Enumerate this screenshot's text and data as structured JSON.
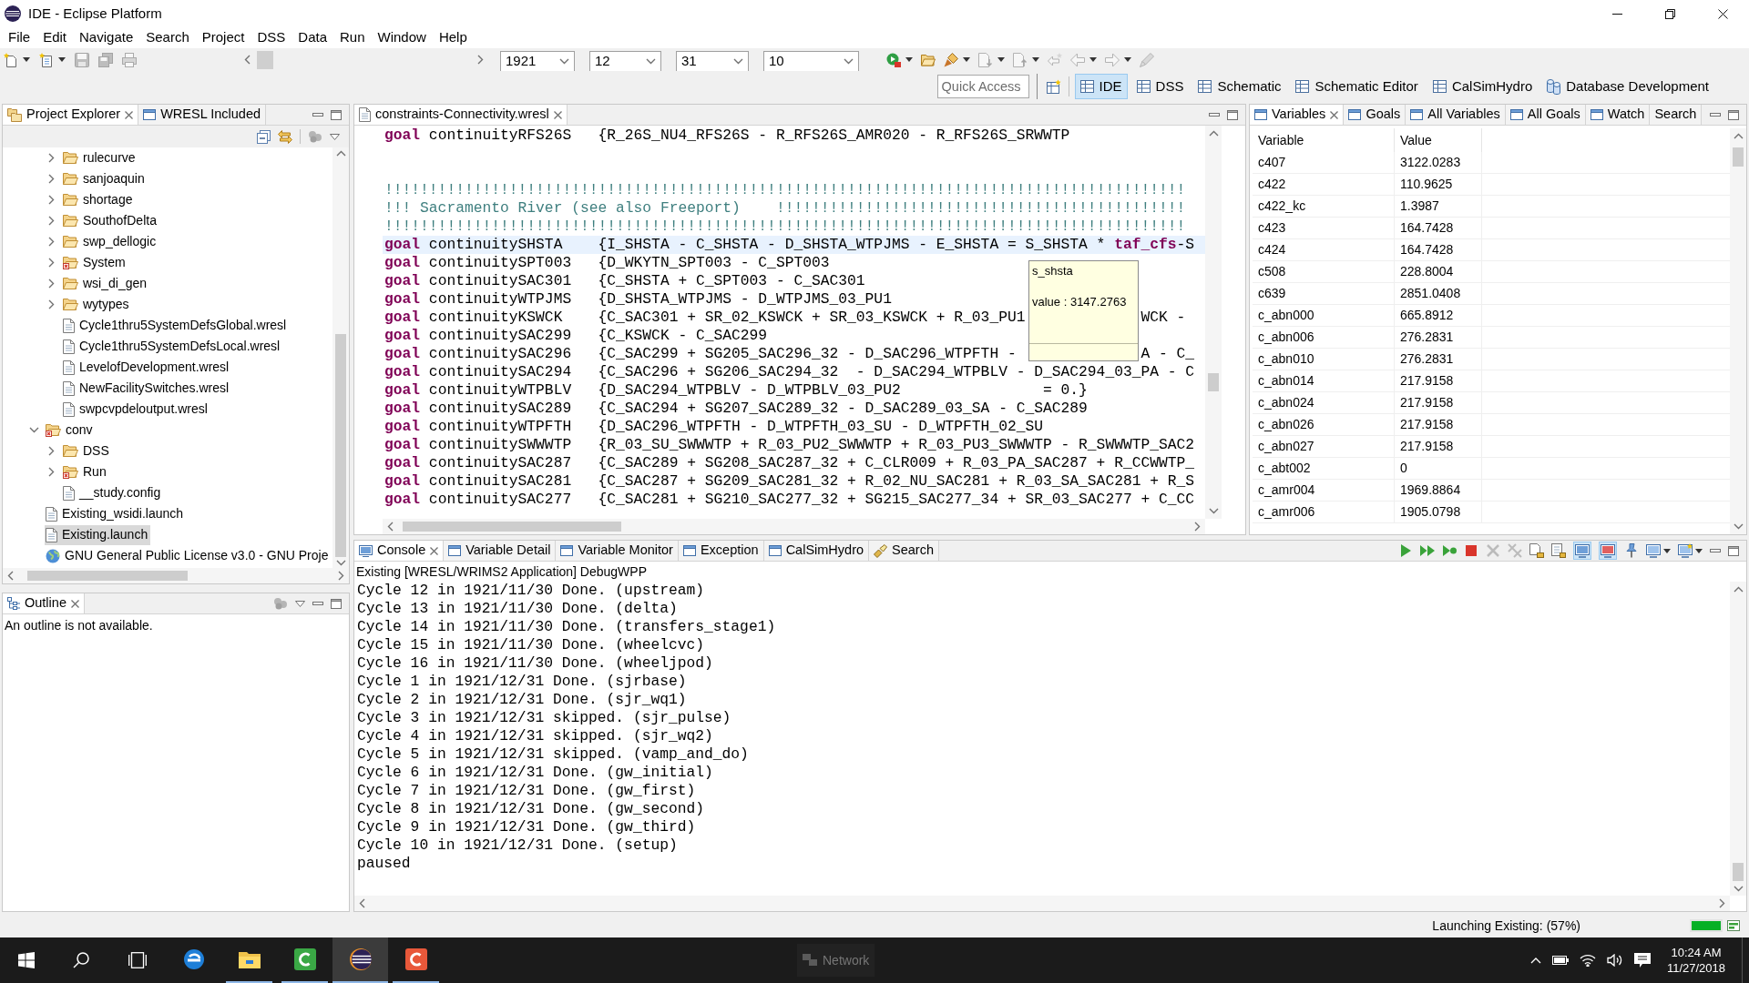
{
  "window": {
    "title": "IDE - Eclipse Platform"
  },
  "menu": [
    "File",
    "Edit",
    "Navigate",
    "Search",
    "Project",
    "DSS",
    "Data",
    "Run",
    "Window",
    "Help"
  ],
  "toolbar": {
    "file_buttons": [
      {
        "disabled": false,
        "dropdown": true
      },
      {
        "disabled": false,
        "dropdown": true
      },
      {
        "disabled": true,
        "dropdown": false
      },
      {
        "disabled": true,
        "dropdown": false
      },
      {
        "disabled": true,
        "dropdown": false
      }
    ],
    "date_fields": [
      {
        "value": "1921"
      },
      {
        "value": "12"
      },
      {
        "value": "31"
      },
      {
        "value": "10"
      }
    ],
    "run_buttons": [
      {
        "disabled": false,
        "dropdown": true
      },
      {
        "disabled": false,
        "dropdown": false
      },
      {
        "disabled": false,
        "dropdown": true
      },
      {
        "disabled": true,
        "dropdown": true
      },
      {
        "disabled": true,
        "dropdown": true
      },
      {
        "disabled": true,
        "dropdown": false
      },
      {
        "disabled": true,
        "dropdown": true
      },
      {
        "disabled": true,
        "dropdown": true
      },
      {
        "disabled": true,
        "dropdown": false
      }
    ],
    "quick_access": {
      "placeholder": "Quick Access"
    },
    "perspectives": [
      {
        "label": "IDE",
        "kind": "grid",
        "selected": true
      },
      {
        "label": "DSS",
        "kind": "grid",
        "selected": false
      },
      {
        "label": "Schematic",
        "kind": "grid",
        "selected": false
      },
      {
        "label": "Schematic Editor",
        "kind": "grid",
        "selected": false
      },
      {
        "label": "CalSimHydro",
        "kind": "grid",
        "selected": false
      },
      {
        "label": "Database Development",
        "kind": "database",
        "selected": false
      }
    ]
  },
  "project_explorer": {
    "tabs": [
      {
        "label": "Project Explorer",
        "kind": "explorer",
        "selected": true
      },
      {
        "label": "WRESL Included",
        "kind": "view",
        "selected": false
      }
    ],
    "tree": {
      "continued_children": [
        {
          "label": "rulecurve",
          "kind": "folder",
          "expanded": false,
          "error": false,
          "selected": false
        },
        {
          "label": "sanjoaquin",
          "kind": "folder",
          "expanded": false,
          "error": false,
          "selected": false
        },
        {
          "label": "shortage",
          "kind": "folder",
          "expanded": false,
          "error": false,
          "selected": false
        },
        {
          "label": "SouthofDelta",
          "kind": "folder",
          "expanded": false,
          "error": false,
          "selected": false
        },
        {
          "label": "swp_dellogic",
          "kind": "folder",
          "expanded": false,
          "error": false,
          "selected": false
        },
        {
          "label": "System",
          "kind": "folder",
          "expanded": false,
          "error": true,
          "selected": false
        },
        {
          "label": "wsi_di_gen",
          "kind": "folder",
          "expanded": false,
          "error": false,
          "selected": false
        },
        {
          "label": "wytypes",
          "kind": "folder",
          "expanded": false,
          "error": false,
          "selected": false
        },
        {
          "label": "Cycle1thru5SystemDefsGlobal.wresl",
          "kind": "file",
          "error": false,
          "selected": false
        },
        {
          "label": "Cycle1thru5SystemDefsLocal.wresl",
          "kind": "file",
          "error": false,
          "selected": false
        },
        {
          "label": "LevelofDevelopment.wresl",
          "kind": "file",
          "error": false,
          "selected": false
        },
        {
          "label": "NewFacilitySwitches.wresl",
          "kind": "file",
          "error": false,
          "selected": false
        },
        {
          "label": "swpcvpdeloutput.wresl",
          "kind": "file",
          "error": false,
          "selected": false
        }
      ],
      "items": [
        {
          "label": "conv",
          "kind": "folder",
          "expanded": true,
          "error": true,
          "selected": false,
          "children": [
            {
              "label": "DSS",
              "kind": "folder",
              "expanded": false,
              "error": false,
              "selected": false
            },
            {
              "label": "Run",
              "kind": "folder",
              "expanded": false,
              "error": true,
              "selected": false
            },
            {
              "label": "__study.config",
              "kind": "file",
              "error": false,
              "selected": false
            }
          ]
        },
        {
          "label": "Existing_wsidi.launch",
          "kind": "file",
          "error": false,
          "selected": false
        },
        {
          "label": "Existing.launch",
          "kind": "file",
          "error": false,
          "selected": true
        },
        {
          "label": "GNU General Public License v3.0 - GNU Proje",
          "kind": "link",
          "error": false,
          "selected": false
        }
      ]
    }
  },
  "outline": {
    "tabs": [
      {
        "label": "Outline",
        "kind": "outline",
        "selected": true
      }
    ],
    "message": "An outline is not available."
  },
  "editor": {
    "tabs": [
      {
        "label": "constraints-Connectivity.wresl",
        "kind": "file",
        "selected": true
      }
    ],
    "lines": [
      {
        "kind": "goal",
        "keyword": "goal",
        "name": "continuityRFS26S",
        "expr": "{R_26S_NU4_RFS26S - R_RFS26S_AMR020 - R_RFS26S_SRWWTP",
        "current": false
      },
      {
        "kind": "blank",
        "current": false
      },
      {
        "kind": "blank",
        "current": false
      },
      {
        "kind": "comment",
        "text": "!!!!!!!!!!!!!!!!!!!!!!!!!!!!!!!!!!!!!!!!!!!!!!!!!!!!!!!!!!!!!!!!!!!!!!!!!!!!!!!!!!!!!!!!!!",
        "current": false
      },
      {
        "kind": "comment",
        "text": "!!! Sacramento River (see also Freeport)    !!!!!!!!!!!!!!!!!!!!!!!!!!!!!!!!!!!!!!!!!!!!!!",
        "current": false
      },
      {
        "kind": "comment",
        "text": "!!!!!!!!!!!!!!!!!!!!!!!!!!!!!!!!!!!!!!!!!!!!!!!!!!!!!!!!!!!!!!!!!!!!!!!!!!!!!!!!!!!!!!!!!!",
        "current": false
      },
      {
        "kind": "goal",
        "keyword": "goal",
        "name": "continuitySHSTA",
        "expr": "{I_SHSTA - C_SHSTA - D_SHSTA_WTPJMS - E_SHSTA = S_SHSTA * **taf_cfs**-S",
        "current": true
      },
      {
        "kind": "goal",
        "keyword": "goal",
        "name": "continuitySPT003",
        "expr": "{D_WKYTN_SPT003 - C_SPT003",
        "current": false
      },
      {
        "kind": "goal",
        "keyword": "goal",
        "name": "continuitySAC301",
        "expr": "{C_SHSTA + C_SPT003 - C_SAC301",
        "current": false
      },
      {
        "kind": "goal",
        "keyword": "goal",
        "name": "continuityWTPJMS",
        "expr": "{D_SHSTA_WTPJMS - D_WTPJMS_03_PU1",
        "current": false
      },
      {
        "kind": "goal",
        "keyword": "goal",
        "name": "continuityKSWCK",
        "expr": "{C_SAC301 + SR_02_KSWCK + SR_03_KSWCK + R_03_PU1",
        "tail": "WCK -",
        "current": false
      },
      {
        "kind": "goal",
        "keyword": "goal",
        "name": "continuitySAC299",
        "expr": "{C_KSWCK - C_SAC299",
        "current": false
      },
      {
        "kind": "goal",
        "keyword": "goal",
        "name": "continuitySAC296",
        "expr": "{C_SAC299 + SG205_SAC296_32 - D_SAC296_WTPFTH -",
        "tail": "A - C_",
        "current": false
      },
      {
        "kind": "goal",
        "keyword": "goal",
        "name": "continuitySAC294",
        "expr": "{C_SAC296 + SG206_SAC294_32  - D_SAC294_WTPBLV - D_SAC294_03_PA - C",
        "current": false
      },
      {
        "kind": "goal",
        "keyword": "goal",
        "name": "continuityWTPBLV",
        "expr": "{D_SAC294_WTPBLV - D_WTPBLV_03_PU2                = 0.}",
        "current": false
      },
      {
        "kind": "goal",
        "keyword": "goal",
        "name": "continuitySAC289",
        "expr": "{C_SAC294 + SG207_SAC289_32 - D_SAC289_03_SA - C_SAC289",
        "current": false
      },
      {
        "kind": "goal",
        "keyword": "goal",
        "name": "continuityWTPFTH",
        "expr": "{D_SAC296_WTPFTH - D_WTPFTH_03_SU - D_WTPFTH_02_SU",
        "current": false
      },
      {
        "kind": "goal",
        "keyword": "goal",
        "name": "continuitySWWWTP",
        "expr": "{R_03_SU_SWWWTP + R_03_PU2_SWWWTP + R_03_PU3_SWWWTP - R_SWWWTP_SAC2",
        "current": false
      },
      {
        "kind": "goal",
        "keyword": "goal",
        "name": "continuitySAC287",
        "expr": "{C_SAC289 + SG208_SAC287_32 + C_CLR009 + R_03_PA_SAC287 + R_CCWWTP_",
        "current": false
      },
      {
        "kind": "goal",
        "keyword": "goal",
        "name": "continuitySAC281",
        "expr": "{C_SAC287 + SG209_SAC281_32 + R_02_NU_SAC281 + R_03_SA_SAC281 + R_S",
        "current": false
      },
      {
        "kind": "goal",
        "keyword": "goal",
        "name": "continuitySAC277",
        "expr": "{C_SAC281 + SG210_SAC277_32 + SG215_SAC277_34 + SR_03_SAC277 + C_CC",
        "current": false
      }
    ],
    "hover": {
      "title": "s_shsta",
      "value": "value : 3147.2763"
    }
  },
  "variables": {
    "tabs": [
      {
        "label": "Variables",
        "kind": "view",
        "selected": true
      },
      {
        "label": "Goals",
        "kind": "view",
        "selected": false
      },
      {
        "label": "All Variables",
        "kind": "view",
        "selected": false
      },
      {
        "label": "All Goals",
        "kind": "view",
        "selected": false
      },
      {
        "label": "Watch",
        "kind": "view",
        "selected": false
      },
      {
        "label": "Search",
        "kind": "plain",
        "selected": false
      }
    ],
    "columns": [
      "Variable",
      "Value"
    ],
    "rows": [
      [
        "c407",
        "3122.0283"
      ],
      [
        "c422",
        "110.9625"
      ],
      [
        "c422_kc",
        "1.3987"
      ],
      [
        "c423",
        "164.7428"
      ],
      [
        "c424",
        "164.7428"
      ],
      [
        "c508",
        "228.8004"
      ],
      [
        "c639",
        "2851.0408"
      ],
      [
        "c_abn000",
        "665.8912"
      ],
      [
        "c_abn006",
        "276.2831"
      ],
      [
        "c_abn010",
        "276.2831"
      ],
      [
        "c_abn014",
        "217.9158"
      ],
      [
        "c_abn024",
        "217.9158"
      ],
      [
        "c_abn026",
        "217.9158"
      ],
      [
        "c_abn027",
        "217.9158"
      ],
      [
        "c_abt002",
        "0"
      ],
      [
        "c_amr004",
        "1969.8864"
      ],
      [
        "c_amr006",
        "1905.0798"
      ]
    ]
  },
  "console": {
    "tabs": [
      {
        "label": "Console",
        "kind": "console",
        "selected": true
      },
      {
        "label": "Variable Detail",
        "kind": "view",
        "selected": false
      },
      {
        "label": "Variable Monitor",
        "kind": "view",
        "selected": false
      },
      {
        "label": "Exception",
        "kind": "view",
        "selected": false
      },
      {
        "label": "CalSimHydro",
        "kind": "view",
        "selected": false
      },
      {
        "label": "Search",
        "kind": "search",
        "selected": false
      }
    ],
    "buttons": [
      {
        "disabled": false,
        "pressed": false,
        "dropdown": false
      },
      {
        "disabled": false,
        "pressed": false,
        "dropdown": false
      },
      {
        "disabled": false,
        "pressed": false,
        "dropdown": false
      },
      {
        "disabled": false,
        "pressed": false,
        "dropdown": false
      },
      {
        "disabled": true,
        "pressed": false,
        "dropdown": false
      },
      {
        "disabled": true,
        "pressed": false,
        "dropdown": false
      },
      {
        "disabled": false,
        "pressed": false,
        "dropdown": false
      },
      {
        "disabled": false,
        "pressed": false,
        "dropdown": false
      },
      {
        "disabled": false,
        "pressed": true,
        "dropdown": false
      },
      {
        "disabled": false,
        "pressed": true,
        "dropdown": false
      },
      {
        "disabled": false,
        "pressed": false,
        "dropdown": false
      },
      {
        "disabled": false,
        "pressed": false,
        "dropdown": true
      },
      {
        "disabled": false,
        "pressed": false,
        "dropdown": true
      }
    ],
    "process": "Existing [WRESL/WRIMS2 Application] DebugWPP",
    "lines": [
      "Cycle 12 in 1921/11/30 Done. (upstream)",
      "Cycle 13 in 1921/11/30 Done. (delta)",
      "Cycle 14 in 1921/11/30 Done. (transfers_stage1)",
      "Cycle 15 in 1921/11/30 Done. (wheelcvc)",
      "Cycle 16 in 1921/11/30 Done. (wheeljpod)",
      "Cycle 1 in 1921/12/31 Done. (sjrbase)",
      "Cycle 2 in 1921/12/31 Done. (sjr_wq1)",
      "Cycle 3 in 1921/12/31 skipped. (sjr_pulse)",
      "Cycle 4 in 1921/12/31 skipped. (sjr_wq2)",
      "Cycle 5 in 1921/12/31 skipped. (vamp_and_do)",
      "Cycle 6 in 1921/12/31 Done. (gw_initial)",
      "Cycle 7 in 1921/12/31 Done. (gw_first)",
      "Cycle 8 in 1921/12/31 Done. (gw_second)",
      "Cycle 9 in 1921/12/31 Done. (gw_third)",
      "Cycle 10 in 1921/12/31 Done. (setup)",
      "paused"
    ]
  },
  "status_bar": {
    "task": "Launching Existing: (57%)",
    "progress": {
      "level": 1
    }
  },
  "taskbar": {
    "apps": [
      {
        "active": false,
        "running": false
      },
      {
        "active": false,
        "running": true
      },
      {
        "active": false,
        "running": true
      },
      {
        "active": true,
        "running": true
      },
      {
        "active": false,
        "running": true
      }
    ],
    "notice": "Network",
    "time": "10:24 AM",
    "date": "11/27/2018"
  }
}
